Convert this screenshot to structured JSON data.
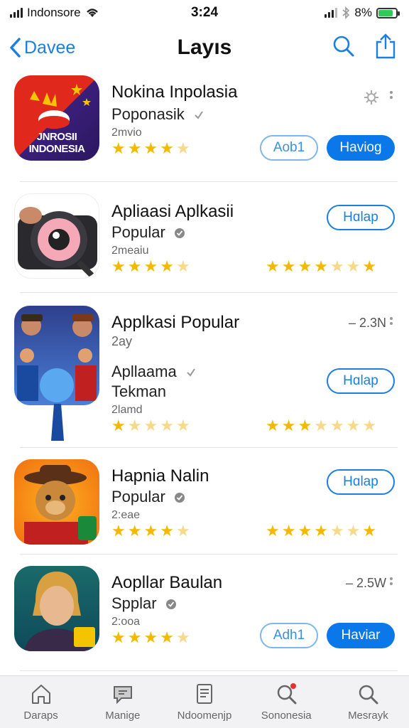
{
  "status": {
    "carrier": "Indonsore",
    "time": "3:24",
    "battery": "8%"
  },
  "nav": {
    "back_label": "Davee",
    "title": "Layıs"
  },
  "apps": [
    {
      "name": "Nokina Inpolasia",
      "subtitle": "Poponasik",
      "meta": "2mvio",
      "rating": 4.5,
      "icon_label": "JNROSII INDONESIA",
      "buttons": [
        "Aob1",
        "Haviog"
      ]
    },
    {
      "name": "Apliaasi Aplkasii",
      "subtitle": "Popular",
      "meta": "2meaiu",
      "rating": 4.5,
      "rating_right": 5,
      "buttons": [
        "Hɑlap"
      ]
    },
    {
      "name": "Applkasi Popular",
      "subtitle": "Apllaama",
      "subtitle2": "Tekman",
      "extra": "2ay",
      "meta": "2lamd",
      "size": "– 2.3N",
      "rating": 1,
      "rating_right": 3.5,
      "buttons": [
        "Hɑlap"
      ]
    },
    {
      "name": "Hapnia Nalin",
      "subtitle": "Popular",
      "meta": "2:eae",
      "rating": 4.5,
      "rating_right": 5,
      "buttons": [
        "Hɑlap"
      ]
    },
    {
      "name": "Aopllar Baulan",
      "subtitle": "Spplar",
      "meta": "2:ooa",
      "size": "– 2.5W",
      "rating": 4.5,
      "buttons": [
        "Adh1",
        "Haviar"
      ]
    }
  ],
  "tabs": [
    "Daraps",
    "Manige",
    "Ndoomenjp",
    "Sononesia",
    "Mesrayk"
  ],
  "colors": {
    "accent": "#0a78e8",
    "star": "#f5b800"
  }
}
